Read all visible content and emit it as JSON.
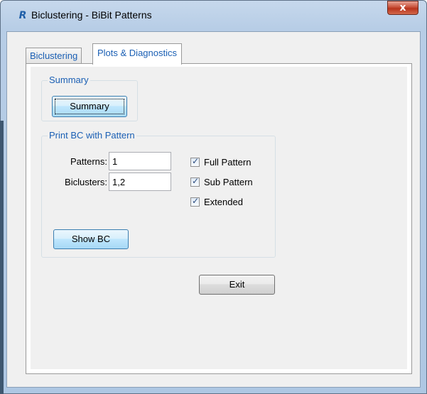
{
  "window": {
    "title": "Biclustering - BiBit Patterns",
    "app_icon": "R",
    "close_glyph": "x"
  },
  "tabs": [
    {
      "label": "Biclustering",
      "active": false
    },
    {
      "label": "Plots & Diagnostics",
      "active": true
    }
  ],
  "summary_group": {
    "title": "Summary",
    "button_label": "Summary"
  },
  "print_group": {
    "title": "Print BC with Pattern",
    "patterns_label": "Patterns:",
    "patterns_value": "1",
    "biclusters_label": "Biclusters:",
    "biclusters_value": "1,2",
    "checkboxes": [
      {
        "label": "Full Pattern",
        "checked": true
      },
      {
        "label": "Sub Pattern",
        "checked": true
      },
      {
        "label": "Extended",
        "checked": true
      }
    ],
    "show_button_label": "Show BC"
  },
  "exit_button_label": "Exit",
  "colors": {
    "accent_text": "#1a5fb4",
    "close_button": "#c7513a",
    "window_frame": "#b7cde6"
  }
}
